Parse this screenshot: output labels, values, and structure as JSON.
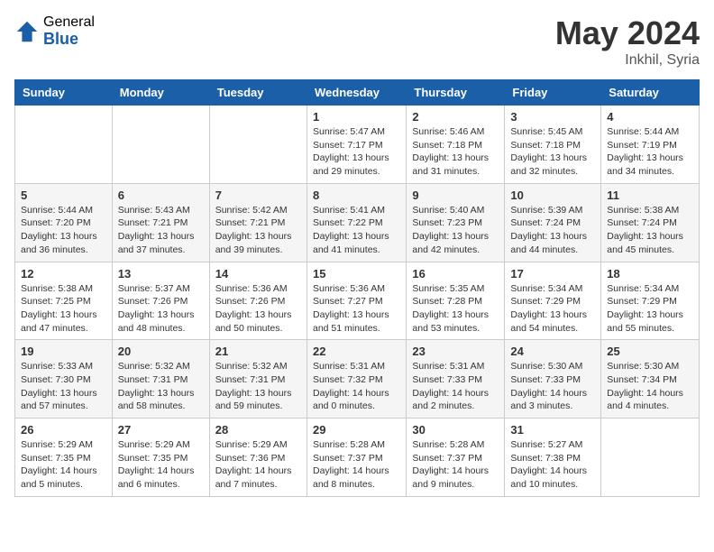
{
  "header": {
    "logo_general": "General",
    "logo_blue": "Blue",
    "title": "May 2024",
    "location": "Inkhil, Syria"
  },
  "weekdays": [
    "Sunday",
    "Monday",
    "Tuesday",
    "Wednesday",
    "Thursday",
    "Friday",
    "Saturday"
  ],
  "weeks": [
    [
      {
        "day": "",
        "info": ""
      },
      {
        "day": "",
        "info": ""
      },
      {
        "day": "",
        "info": ""
      },
      {
        "day": "1",
        "info": "Sunrise: 5:47 AM\nSunset: 7:17 PM\nDaylight: 13 hours\nand 29 minutes."
      },
      {
        "day": "2",
        "info": "Sunrise: 5:46 AM\nSunset: 7:18 PM\nDaylight: 13 hours\nand 31 minutes."
      },
      {
        "day": "3",
        "info": "Sunrise: 5:45 AM\nSunset: 7:18 PM\nDaylight: 13 hours\nand 32 minutes."
      },
      {
        "day": "4",
        "info": "Sunrise: 5:44 AM\nSunset: 7:19 PM\nDaylight: 13 hours\nand 34 minutes."
      }
    ],
    [
      {
        "day": "5",
        "info": "Sunrise: 5:44 AM\nSunset: 7:20 PM\nDaylight: 13 hours\nand 36 minutes."
      },
      {
        "day": "6",
        "info": "Sunrise: 5:43 AM\nSunset: 7:21 PM\nDaylight: 13 hours\nand 37 minutes."
      },
      {
        "day": "7",
        "info": "Sunrise: 5:42 AM\nSunset: 7:21 PM\nDaylight: 13 hours\nand 39 minutes."
      },
      {
        "day": "8",
        "info": "Sunrise: 5:41 AM\nSunset: 7:22 PM\nDaylight: 13 hours\nand 41 minutes."
      },
      {
        "day": "9",
        "info": "Sunrise: 5:40 AM\nSunset: 7:23 PM\nDaylight: 13 hours\nand 42 minutes."
      },
      {
        "day": "10",
        "info": "Sunrise: 5:39 AM\nSunset: 7:24 PM\nDaylight: 13 hours\nand 44 minutes."
      },
      {
        "day": "11",
        "info": "Sunrise: 5:38 AM\nSunset: 7:24 PM\nDaylight: 13 hours\nand 45 minutes."
      }
    ],
    [
      {
        "day": "12",
        "info": "Sunrise: 5:38 AM\nSunset: 7:25 PM\nDaylight: 13 hours\nand 47 minutes."
      },
      {
        "day": "13",
        "info": "Sunrise: 5:37 AM\nSunset: 7:26 PM\nDaylight: 13 hours\nand 48 minutes."
      },
      {
        "day": "14",
        "info": "Sunrise: 5:36 AM\nSunset: 7:26 PM\nDaylight: 13 hours\nand 50 minutes."
      },
      {
        "day": "15",
        "info": "Sunrise: 5:36 AM\nSunset: 7:27 PM\nDaylight: 13 hours\nand 51 minutes."
      },
      {
        "day": "16",
        "info": "Sunrise: 5:35 AM\nSunset: 7:28 PM\nDaylight: 13 hours\nand 53 minutes."
      },
      {
        "day": "17",
        "info": "Sunrise: 5:34 AM\nSunset: 7:29 PM\nDaylight: 13 hours\nand 54 minutes."
      },
      {
        "day": "18",
        "info": "Sunrise: 5:34 AM\nSunset: 7:29 PM\nDaylight: 13 hours\nand 55 minutes."
      }
    ],
    [
      {
        "day": "19",
        "info": "Sunrise: 5:33 AM\nSunset: 7:30 PM\nDaylight: 13 hours\nand 57 minutes."
      },
      {
        "day": "20",
        "info": "Sunrise: 5:32 AM\nSunset: 7:31 PM\nDaylight: 13 hours\nand 58 minutes."
      },
      {
        "day": "21",
        "info": "Sunrise: 5:32 AM\nSunset: 7:31 PM\nDaylight: 13 hours\nand 59 minutes."
      },
      {
        "day": "22",
        "info": "Sunrise: 5:31 AM\nSunset: 7:32 PM\nDaylight: 14 hours\nand 0 minutes."
      },
      {
        "day": "23",
        "info": "Sunrise: 5:31 AM\nSunset: 7:33 PM\nDaylight: 14 hours\nand 2 minutes."
      },
      {
        "day": "24",
        "info": "Sunrise: 5:30 AM\nSunset: 7:33 PM\nDaylight: 14 hours\nand 3 minutes."
      },
      {
        "day": "25",
        "info": "Sunrise: 5:30 AM\nSunset: 7:34 PM\nDaylight: 14 hours\nand 4 minutes."
      }
    ],
    [
      {
        "day": "26",
        "info": "Sunrise: 5:29 AM\nSunset: 7:35 PM\nDaylight: 14 hours\nand 5 minutes."
      },
      {
        "day": "27",
        "info": "Sunrise: 5:29 AM\nSunset: 7:35 PM\nDaylight: 14 hours\nand 6 minutes."
      },
      {
        "day": "28",
        "info": "Sunrise: 5:29 AM\nSunset: 7:36 PM\nDaylight: 14 hours\nand 7 minutes."
      },
      {
        "day": "29",
        "info": "Sunrise: 5:28 AM\nSunset: 7:37 PM\nDaylight: 14 hours\nand 8 minutes."
      },
      {
        "day": "30",
        "info": "Sunrise: 5:28 AM\nSunset: 7:37 PM\nDaylight: 14 hours\nand 9 minutes."
      },
      {
        "day": "31",
        "info": "Sunrise: 5:27 AM\nSunset: 7:38 PM\nDaylight: 14 hours\nand 10 minutes."
      },
      {
        "day": "",
        "info": ""
      }
    ]
  ]
}
